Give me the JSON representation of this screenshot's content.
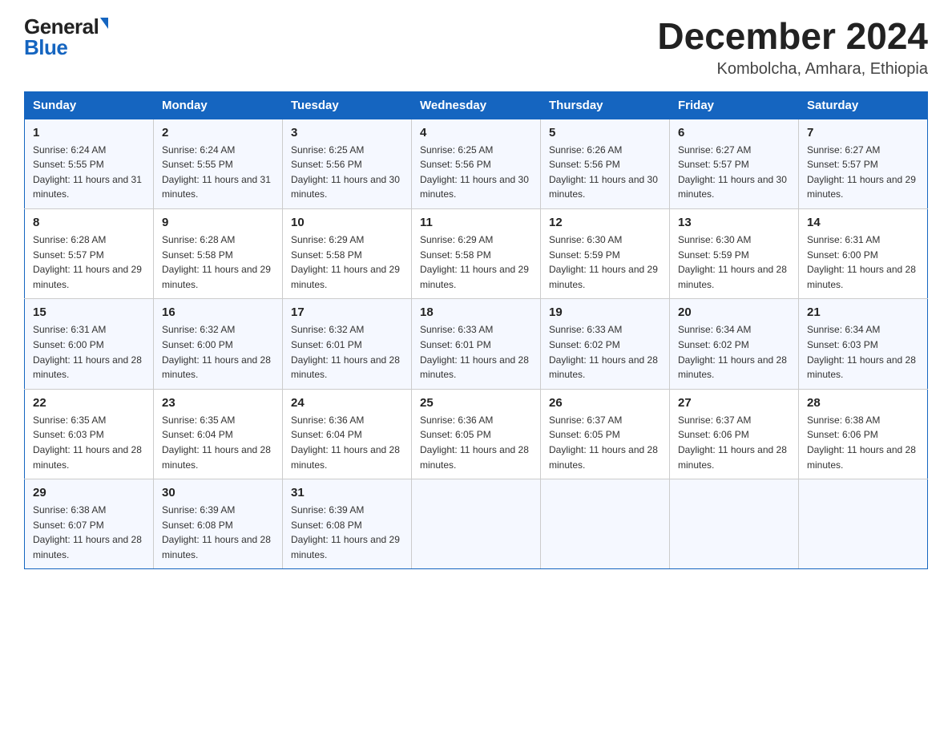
{
  "logo": {
    "general": "General",
    "blue": "Blue"
  },
  "title": "December 2024",
  "location": "Kombolcha, Amhara, Ethiopia",
  "days_of_week": [
    "Sunday",
    "Monday",
    "Tuesday",
    "Wednesday",
    "Thursday",
    "Friday",
    "Saturday"
  ],
  "weeks": [
    [
      {
        "day": "1",
        "sunrise": "6:24 AM",
        "sunset": "5:55 PM",
        "daylight": "11 hours and 31 minutes."
      },
      {
        "day": "2",
        "sunrise": "6:24 AM",
        "sunset": "5:55 PM",
        "daylight": "11 hours and 31 minutes."
      },
      {
        "day": "3",
        "sunrise": "6:25 AM",
        "sunset": "5:56 PM",
        "daylight": "11 hours and 30 minutes."
      },
      {
        "day": "4",
        "sunrise": "6:25 AM",
        "sunset": "5:56 PM",
        "daylight": "11 hours and 30 minutes."
      },
      {
        "day": "5",
        "sunrise": "6:26 AM",
        "sunset": "5:56 PM",
        "daylight": "11 hours and 30 minutes."
      },
      {
        "day": "6",
        "sunrise": "6:27 AM",
        "sunset": "5:57 PM",
        "daylight": "11 hours and 30 minutes."
      },
      {
        "day": "7",
        "sunrise": "6:27 AM",
        "sunset": "5:57 PM",
        "daylight": "11 hours and 29 minutes."
      }
    ],
    [
      {
        "day": "8",
        "sunrise": "6:28 AM",
        "sunset": "5:57 PM",
        "daylight": "11 hours and 29 minutes."
      },
      {
        "day": "9",
        "sunrise": "6:28 AM",
        "sunset": "5:58 PM",
        "daylight": "11 hours and 29 minutes."
      },
      {
        "day": "10",
        "sunrise": "6:29 AM",
        "sunset": "5:58 PM",
        "daylight": "11 hours and 29 minutes."
      },
      {
        "day": "11",
        "sunrise": "6:29 AM",
        "sunset": "5:58 PM",
        "daylight": "11 hours and 29 minutes."
      },
      {
        "day": "12",
        "sunrise": "6:30 AM",
        "sunset": "5:59 PM",
        "daylight": "11 hours and 29 minutes."
      },
      {
        "day": "13",
        "sunrise": "6:30 AM",
        "sunset": "5:59 PM",
        "daylight": "11 hours and 28 minutes."
      },
      {
        "day": "14",
        "sunrise": "6:31 AM",
        "sunset": "6:00 PM",
        "daylight": "11 hours and 28 minutes."
      }
    ],
    [
      {
        "day": "15",
        "sunrise": "6:31 AM",
        "sunset": "6:00 PM",
        "daylight": "11 hours and 28 minutes."
      },
      {
        "day": "16",
        "sunrise": "6:32 AM",
        "sunset": "6:00 PM",
        "daylight": "11 hours and 28 minutes."
      },
      {
        "day": "17",
        "sunrise": "6:32 AM",
        "sunset": "6:01 PM",
        "daylight": "11 hours and 28 minutes."
      },
      {
        "day": "18",
        "sunrise": "6:33 AM",
        "sunset": "6:01 PM",
        "daylight": "11 hours and 28 minutes."
      },
      {
        "day": "19",
        "sunrise": "6:33 AM",
        "sunset": "6:02 PM",
        "daylight": "11 hours and 28 minutes."
      },
      {
        "day": "20",
        "sunrise": "6:34 AM",
        "sunset": "6:02 PM",
        "daylight": "11 hours and 28 minutes."
      },
      {
        "day": "21",
        "sunrise": "6:34 AM",
        "sunset": "6:03 PM",
        "daylight": "11 hours and 28 minutes."
      }
    ],
    [
      {
        "day": "22",
        "sunrise": "6:35 AM",
        "sunset": "6:03 PM",
        "daylight": "11 hours and 28 minutes."
      },
      {
        "day": "23",
        "sunrise": "6:35 AM",
        "sunset": "6:04 PM",
        "daylight": "11 hours and 28 minutes."
      },
      {
        "day": "24",
        "sunrise": "6:36 AM",
        "sunset": "6:04 PM",
        "daylight": "11 hours and 28 minutes."
      },
      {
        "day": "25",
        "sunrise": "6:36 AM",
        "sunset": "6:05 PM",
        "daylight": "11 hours and 28 minutes."
      },
      {
        "day": "26",
        "sunrise": "6:37 AM",
        "sunset": "6:05 PM",
        "daylight": "11 hours and 28 minutes."
      },
      {
        "day": "27",
        "sunrise": "6:37 AM",
        "sunset": "6:06 PM",
        "daylight": "11 hours and 28 minutes."
      },
      {
        "day": "28",
        "sunrise": "6:38 AM",
        "sunset": "6:06 PM",
        "daylight": "11 hours and 28 minutes."
      }
    ],
    [
      {
        "day": "29",
        "sunrise": "6:38 AM",
        "sunset": "6:07 PM",
        "daylight": "11 hours and 28 minutes."
      },
      {
        "day": "30",
        "sunrise": "6:39 AM",
        "sunset": "6:08 PM",
        "daylight": "11 hours and 28 minutes."
      },
      {
        "day": "31",
        "sunrise": "6:39 AM",
        "sunset": "6:08 PM",
        "daylight": "11 hours and 29 minutes."
      },
      null,
      null,
      null,
      null
    ]
  ]
}
